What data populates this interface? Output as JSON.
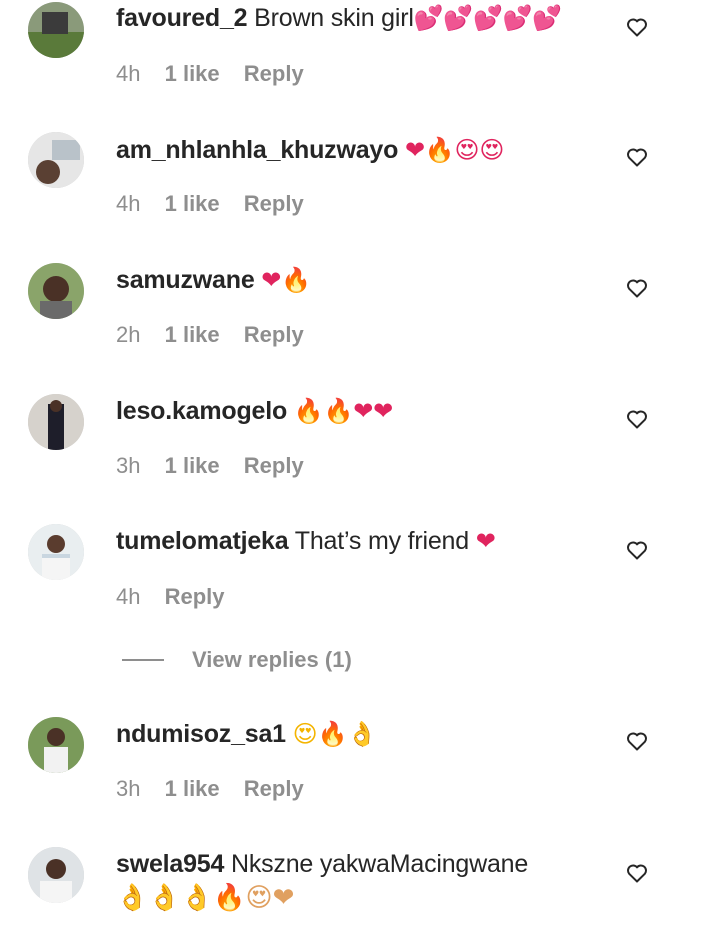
{
  "comments": [
    {
      "username": "favoured_2",
      "text": "Brown skin girl",
      "emoji": "💕💕💕💕💕",
      "time": "4h",
      "likes": "1 like",
      "reply": "Reply"
    },
    {
      "username": "am_nhlanhla_khuzwayo",
      "text": "",
      "emoji": "❤🔥😍😍",
      "time": "4h",
      "likes": "1 like",
      "reply": "Reply"
    },
    {
      "username": "samuzwane",
      "text": "",
      "emoji": "❤🔥",
      "time": "2h",
      "likes": "1 like",
      "reply": "Reply"
    },
    {
      "username": "leso.kamogelo",
      "text": "",
      "emoji": "🔥🔥❤❤",
      "time": "3h",
      "likes": "1 like",
      "reply": "Reply"
    },
    {
      "username": "tumelomatjeka",
      "text": "That’s my friend",
      "emoji": "❤",
      "time": "4h",
      "likes": "",
      "reply": "Reply"
    },
    {
      "username": "ndumisoz_sa1",
      "text": "",
      "emoji": "😍🔥👌",
      "time": "3h",
      "likes": "1 like",
      "reply": "Reply"
    },
    {
      "username": "swela954",
      "text": "Nkszne yakwaMacingwane",
      "emoji": "👌👌👌🔥😍❤",
      "time": "",
      "likes": "",
      "reply": ""
    }
  ],
  "view_replies": "View replies (1)",
  "icons": {
    "like": "heart-outline-icon",
    "avatar": "avatar"
  },
  "colors": {
    "text": "#262626",
    "muted": "#8e8e8e",
    "background": "#ffffff"
  }
}
